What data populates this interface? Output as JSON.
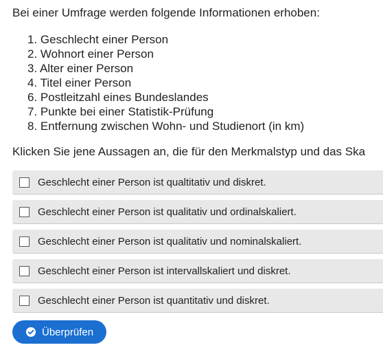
{
  "intro": "Bei einer Umfrage werden folgende Informationen erhoben:",
  "items": [
    "1. Geschlecht einer Person",
    "2. Wohnort einer Person",
    "3. Alter einer Person",
    "4. Titel einer Person",
    "6. Postleitzahl eines Bundeslandes",
    "7. Punkte bei einer Statistik-Prüfung",
    "8. Entfernung zwischen Wohn- und Studienort (in km)"
  ],
  "instruction": "Klicken Sie jene Aussagen an, die für den Merkmalstyp und das Ska",
  "options": [
    {
      "label": "Geschlecht einer Person ist qualtitativ und diskret.",
      "checked": false
    },
    {
      "label": "Geschlecht einer Person ist qualitativ und ordinalskaliert.",
      "checked": false
    },
    {
      "label": "Geschlecht einer Person ist qualitativ und nominalskaliert.",
      "checked": false
    },
    {
      "label": "Geschlecht einer Person ist intervallskaliert und diskret.",
      "checked": false
    },
    {
      "label": "Geschlecht einer Person ist quantitativ und diskret.",
      "checked": false
    }
  ],
  "check_button": {
    "label": "Überprüfen",
    "icon": "check-circle-icon",
    "color": "#1a6fd1"
  }
}
